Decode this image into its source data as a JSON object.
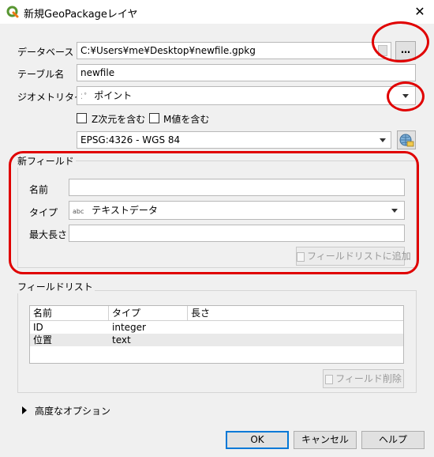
{
  "window": {
    "title": "新規GeoPackageレイヤ",
    "close_glyph": "✕"
  },
  "form": {
    "database_label": "データベース",
    "database_value": "C:¥Users¥me¥Desktop¥newfile.gpkg",
    "browse_label": "…",
    "table_name_label": "テーブル名",
    "table_name_value": "newfile",
    "geometry_type_label": "ジオメトリタイプ",
    "geometry_type_value": "ポイント",
    "z_label": "Z次元を含む",
    "m_label": "M値を含む",
    "crs_value": "EPSG:4326 - WGS 84"
  },
  "new_field": {
    "group_title": "新フィールド",
    "name_label": "名前",
    "name_value": "",
    "type_label": "タイプ",
    "type_icon_text": "abc",
    "type_value": "テキストデータ",
    "max_length_label": "最大長さ",
    "max_length_value": "",
    "add_button_label": "フィールドリストに追加"
  },
  "field_list": {
    "group_title": "フィールドリスト",
    "columns": [
      "名前",
      "タイプ",
      "長さ"
    ],
    "rows": [
      {
        "name": "ID",
        "type": "integer",
        "length": ""
      },
      {
        "name": "位置",
        "type": "text",
        "length": ""
      }
    ],
    "remove_button_label": "フィールド削除"
  },
  "advanced": {
    "label": "高度なオプション"
  },
  "buttons": {
    "ok": "OK",
    "cancel": "キャンセル",
    "help": "ヘルプ"
  },
  "colors": {
    "annotation_red": "#e00000",
    "app_icon_green": "#589632"
  }
}
